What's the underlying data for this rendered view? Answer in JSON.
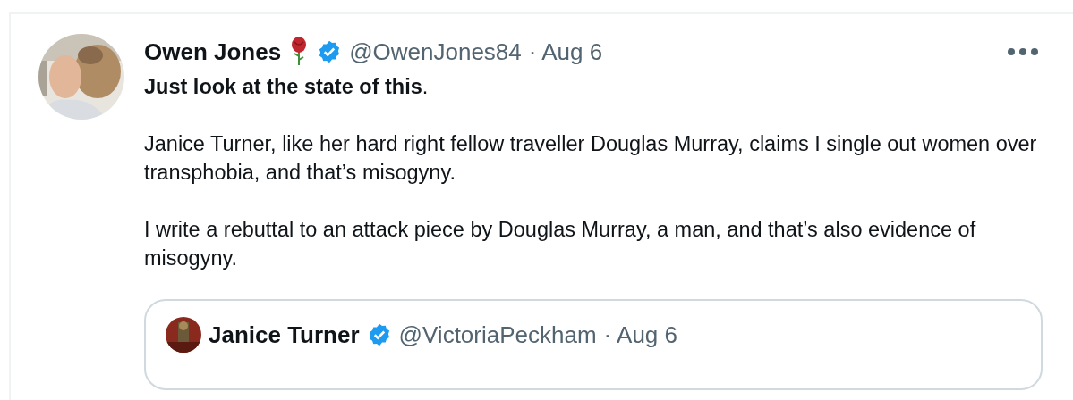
{
  "tweet": {
    "author": {
      "name": "Owen Jones",
      "handle": "@OwenJones84",
      "time": "· Aug 6",
      "verified": true
    },
    "paragraphs": [
      "**Just look at the state of this**.",
      "Janice Turner, like her hard right fellow traveller Douglas Murray, claims I single out women over transphobia, and that’s misogyny.",
      "I write a rebuttal to an attack piece by Douglas Murray, a man, and that’s also evidence of misogyny."
    ],
    "quoted": {
      "author": {
        "name": "Janice Turner",
        "handle": "@VictoriaPeckham",
        "time": "· Aug 6",
        "verified": true
      }
    }
  }
}
